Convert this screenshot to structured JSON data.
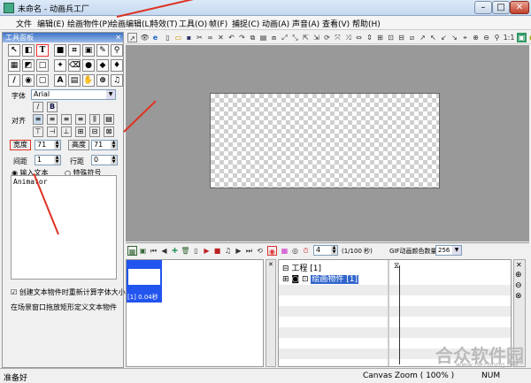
{
  "window": {
    "title": "未命名 - 动画兵工厂"
  },
  "menu": [
    "文件",
    "编辑(E)",
    "绘画物件(P)",
    "绘画编辑(L)",
    "特效(T)",
    "工具(O)",
    "帧(F)",
    "捕捉(C)",
    "动画(A)",
    "声音(A)",
    "查看(V)",
    "帮助(H)"
  ],
  "panel": {
    "title": "工具面板",
    "font_label": "字体",
    "font_value": "Arial",
    "bold_label": "B",
    "align_label": "对齐",
    "width_label": "宽度",
    "width_value": "71",
    "height_label": "高度",
    "height_value": "71",
    "spacing_label": "间距",
    "spacing_value": "1",
    "line_label": "行距",
    "line_value": "0",
    "radio_text": "输入文本",
    "radio_symbol": "特殊符号",
    "text_value": "Animator",
    "checkbox_label": "创建文本物件时重新计算字体大小",
    "hint": "在场景窗口拖放矩形定义文本物件"
  },
  "timeline": {
    "frame_input": "4",
    "frame_count": "(1/100 秒)",
    "gif_label": "GIF动画颜色数量",
    "gif_value": "256",
    "frame_label": "[1] 0.04秒",
    "project_label": "工程 [1]",
    "layer_item": "绘画物件 [1]"
  },
  "status": {
    "left": "准备好",
    "zoom": "Canvas Zoom ( 100% )",
    "num": "NUM"
  },
  "watermark": {
    "main": "合众软件园",
    "url": "www.hezhong.net"
  },
  "colors": {
    "selection": "#3366cc",
    "arrow": "#dd3322",
    "stage": "#999999"
  }
}
